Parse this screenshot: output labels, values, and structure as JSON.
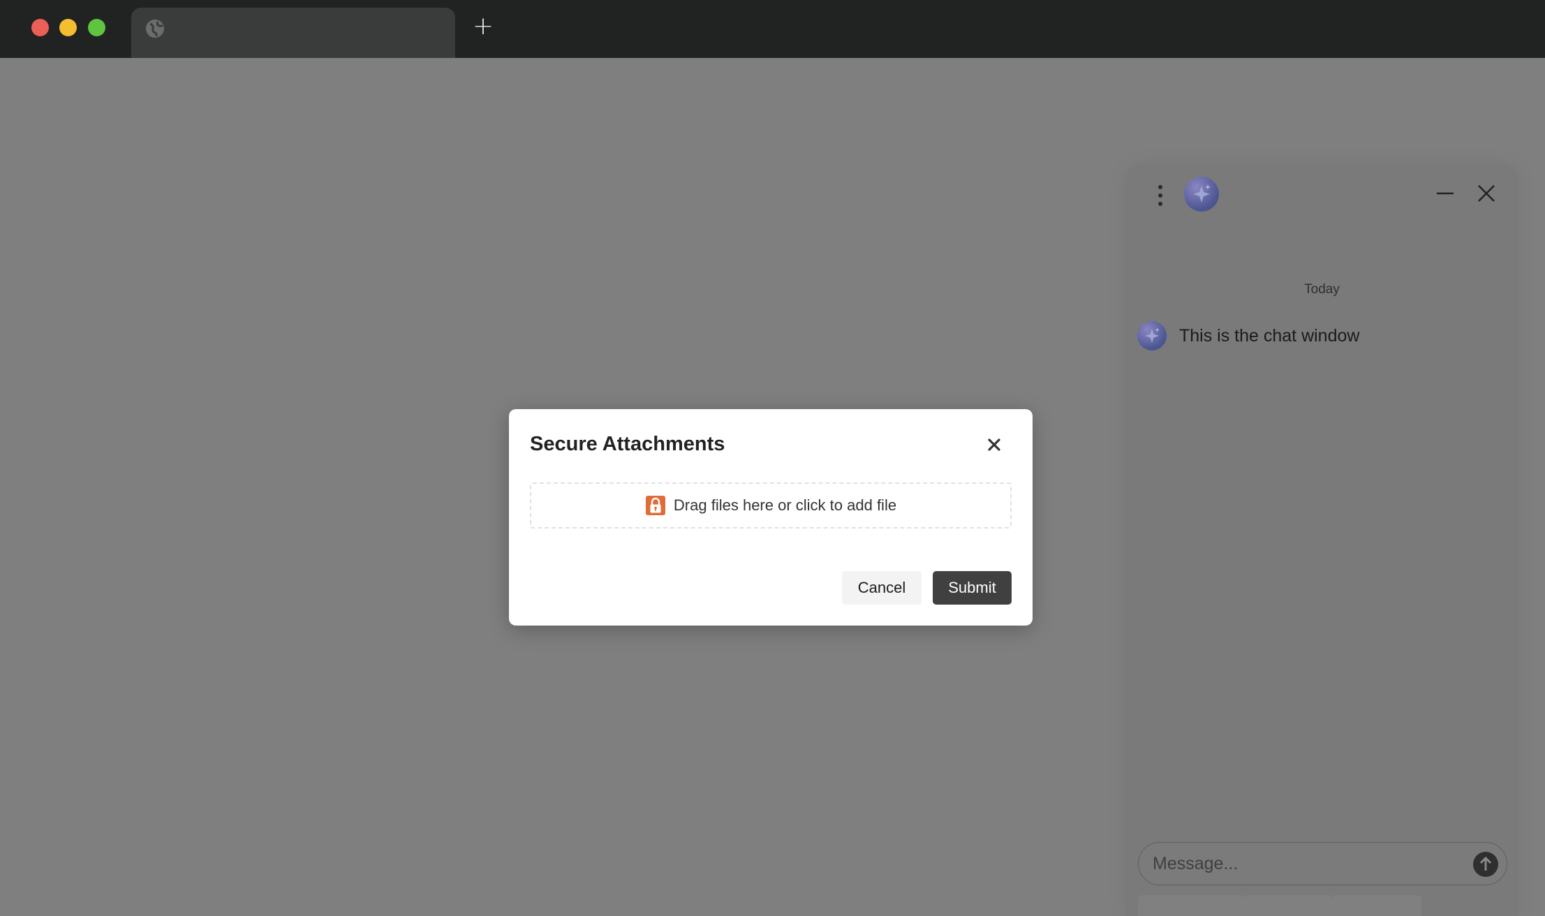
{
  "browser": {
    "tab_title": "",
    "tab_icon": "globe-icon",
    "new_tab_label": "+"
  },
  "chat": {
    "menu_icon": "more-vertical-icon",
    "logo_icon": "sparkle-icon",
    "minimize_icon": "minimize-icon",
    "close_icon": "close-icon",
    "date_separator": "Today",
    "messages": [
      {
        "sender": "bot",
        "text": "This is the chat window"
      }
    ],
    "input": {
      "value": "",
      "placeholder": "Message..."
    },
    "send_icon": "arrow-up-icon"
  },
  "modal": {
    "title": "Secure Attachments",
    "close_icon": "close-icon",
    "dropzone_icon": "lock-icon",
    "dropzone_text": "Drag files here or click to add file",
    "cancel_label": "Cancel",
    "submit_label": "Submit"
  },
  "colors": {
    "overlay": "#7f7f7f",
    "lock_accent": "#e06c37",
    "submit_bg": "#404040",
    "chrome_bg": "#202322"
  }
}
